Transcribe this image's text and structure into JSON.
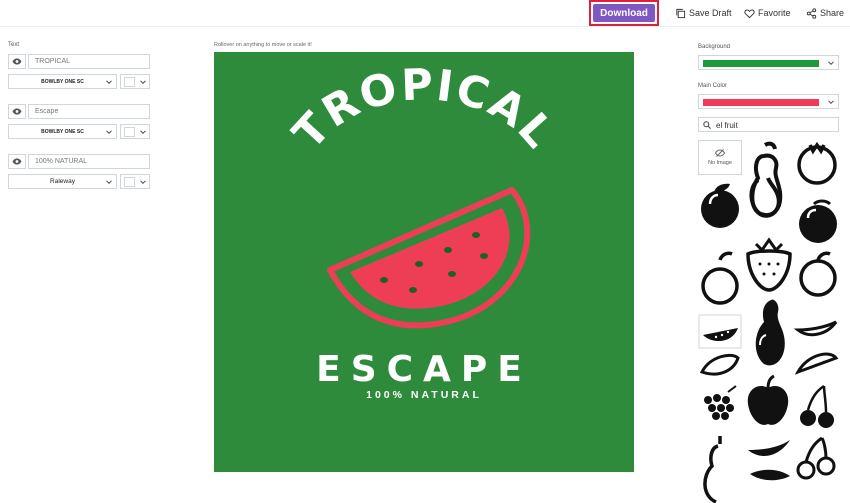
{
  "toolbar": {
    "download_label": "Download",
    "save_draft_label": "Save Draft",
    "favorite_label": "Favorite",
    "share_label": "Share"
  },
  "left_panel": {
    "section_label": "Text",
    "text_groups": [
      {
        "text": "TROPICAL",
        "font": "BOWLBY ONE SC",
        "color": "#ffffff"
      },
      {
        "text": "Escape",
        "font": "BOWLBY ONE SC",
        "color": "#ffffff"
      },
      {
        "text": "100% NATURAL",
        "font": "Raleway",
        "color": "#ffffff"
      }
    ]
  },
  "canvas": {
    "hint": "Rollover on anything to move or scale it!",
    "title": "TROPICAL",
    "subtitle": "ESCAPE",
    "tagline": "100% NATURAL",
    "background_color": "#2e8b3c",
    "main_color": "#ee3e55"
  },
  "right_panel": {
    "background_label": "Background",
    "background_color": "#1e9a3c",
    "main_color_label": "Main Color",
    "main_color": "#f03a58",
    "search_value": "el fruit",
    "no_image_label": "No Image",
    "icon_names": [
      "no-image",
      "pear-icon",
      "pomegranate-icon",
      "peach-icon",
      "mango-icon",
      "apple-icon",
      "apricot-icon",
      "strawberry-icon",
      "apricot-outline-icon",
      "watermelon-icon",
      "pear-solid-icon",
      "banana-outline-icon",
      "mango-small-icon",
      "apple-solid-icon",
      "watermelon-slice-icon",
      "grapes-icon",
      "cherries-icon",
      "pear-outline-icon",
      "banana-icon",
      "cherries-outline-icon"
    ]
  }
}
